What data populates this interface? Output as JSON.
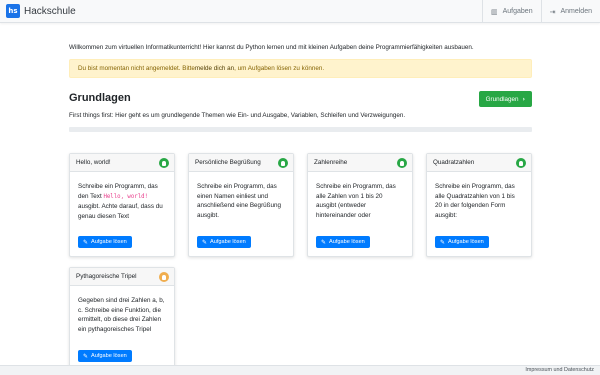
{
  "navbar": {
    "brand_logo": "hs",
    "brand": "Hackschule",
    "items": [
      {
        "label": "Aufgaben",
        "icon": "map-icon",
        "glyph": "▥"
      },
      {
        "label": "Anmelden",
        "icon": "sign-in-icon",
        "glyph": "⇥"
      }
    ]
  },
  "welcome": "Willkommen zum virtuellen Informatikunterricht! Hier kannst du Python lernen und mit kleinen Aufgaben deine Programmierfähigkeiten ausbauen.",
  "alert": {
    "prefix": "Du bist momentan nicht angemeldet. Bitte ",
    "link": "melde dich an",
    "suffix": ", um Aufgaben lösen zu können."
  },
  "section": {
    "title": "Grundlagen",
    "button": "Grundlagen",
    "button_icon": "›",
    "description": "First things first: Hier geht es um grundlegende Themen wie Ein- und Ausgabe, Variablen, Schleifen und Verzweigungen.",
    "progress_percent": 0
  },
  "cards": [
    {
      "title": "Hello, world!",
      "status": "green",
      "body_before": "Schreibe ein Programm, das den Text ",
      "code": "Hello, world!",
      "body_after": " ausgibt. Achte darauf, dass du genau diesen Text",
      "button": "Aufgabe lösen"
    },
    {
      "title": "Persönliche Begrüßung",
      "status": "green",
      "body_before": "Schreibe ein Programm, das einen Namen einliest und anschließend eine Begrüßung ausgibt.",
      "code": "",
      "body_after": "",
      "button": "Aufgabe lösen"
    },
    {
      "title": "Zahlenreihe",
      "status": "green",
      "body_before": "Schreibe ein Programm, das alle Zahlen von 1 bis 20 ausgibt (entweder hintereinander oder",
      "code": "",
      "body_after": "",
      "button": "Aufgabe lösen"
    },
    {
      "title": "Quadratzahlen",
      "status": "green",
      "body_before": "Schreibe ein Programm, das alle Quadratzahlen von 1 bis 20 in der folgenden Form ausgibt:",
      "code": "",
      "body_after": "",
      "button": "Aufgabe lösen"
    },
    {
      "title": "Pythagoreische Tripel",
      "status": "orange",
      "body_before": "Gegeben sind drei Zahlen a, b, c. Schreibe eine Funktion, die ermittelt, ob diese drei Zahlen ein pythagoreisches Tripel",
      "code": "",
      "body_after": "",
      "button": "Aufgabe lösen"
    }
  ],
  "footer": {
    "text": "Impressum und Datenschutz"
  },
  "colors": {
    "primary": "#007bff",
    "success": "#28a745",
    "warning_bg": "#fff3cd",
    "warning_text": "#856404",
    "bulb_orange": "#f0ad4e"
  }
}
